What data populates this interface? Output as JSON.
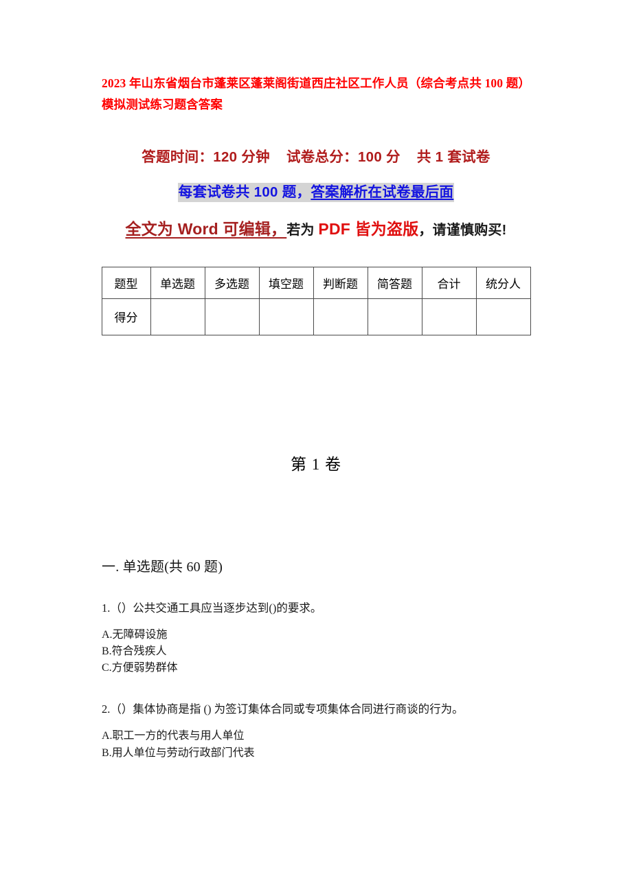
{
  "document": {
    "title": "2023 年山东省烟台市蓬莱区蓬莱阁街道西庄社区工作人员（综合考点共 100 题）模拟测试练习题含答案"
  },
  "exam_meta": {
    "line1": "答题时间：120 分钟    试卷总分：100 分    共 1 套试卷",
    "line2_part1": "每套试卷共 100 题，",
    "line2_part2": "答案解析在试卷最后面",
    "line3_part1": "全文为 Word 可编辑，",
    "line3_part2": "若为 ",
    "line3_part3": "PDF 皆为盗版",
    "line3_part4": "，请谨慎购买!",
    "colors": {
      "title_red": "#ff0000",
      "meta_dark_red": "#b01c1c",
      "meta_blue": "#1414e0",
      "highlight_gray": "#d4d4d4",
      "bright_red": "#e01010",
      "dark_red_underline": "#a52020"
    }
  },
  "score_table": {
    "headers": [
      "题型",
      "单选题",
      "多选题",
      "填空题",
      "判断题",
      "简答题",
      "合计",
      "统分人"
    ],
    "rows": [
      {
        "label": "得分",
        "cells": [
          "",
          "",
          "",
          "",
          "",
          "",
          ""
        ]
      }
    ]
  },
  "volume": {
    "heading": "第 1 卷"
  },
  "sections": [
    {
      "heading": "一. 单选题(共 60 题)",
      "questions": [
        {
          "text": "1.（）公共交通工具应当逐步达到()的要求。",
          "options": [
            "A.无障碍设施",
            "B.符合残疾人",
            "C.方便弱势群体"
          ]
        },
        {
          "text": "2.（）集体协商是指 () 为签订集体合同或专项集体合同进行商谈的行为。",
          "options": [
            "A.职工一方的代表与用人单位",
            "B.用人单位与劳动行政部门代表"
          ]
        }
      ]
    }
  ]
}
